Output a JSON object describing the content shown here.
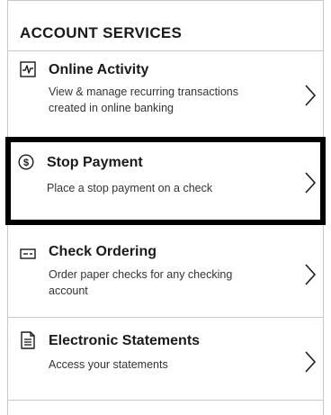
{
  "section": {
    "title": "ACCOUNT SERVICES"
  },
  "items": [
    {
      "icon": "activity-chart-icon",
      "title": "Online Activity",
      "description": "View & manage recurring transactions created in online banking"
    },
    {
      "icon": "dollar-circle-icon",
      "title": "Stop Payment",
      "description": "Place a stop payment on a check"
    },
    {
      "icon": "check-icon",
      "title": "Check Ordering",
      "description": "Order paper checks for any checking account"
    },
    {
      "icon": "document-icon",
      "title": "Electronic Statements",
      "description": "Access your statements"
    }
  ],
  "colors": {
    "highlight_border": "#000000",
    "divider": "#c8c8c8",
    "text": "#1a1a1a"
  }
}
